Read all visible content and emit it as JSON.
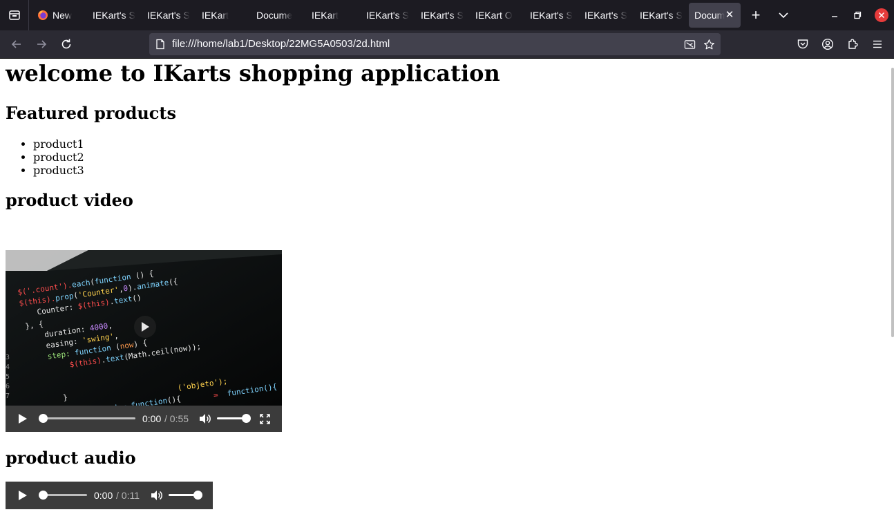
{
  "browser": {
    "tabs": [
      {
        "label": "New",
        "favicon": "firefox-icon"
      },
      {
        "label": "IEKart's S"
      },
      {
        "label": "IEKart's S"
      },
      {
        "label": "IEKart"
      },
      {
        "label": "Docume"
      },
      {
        "label": "IEKart"
      },
      {
        "label": "IEKart's S"
      },
      {
        "label": "IEKart's S"
      },
      {
        "label": "IEKart O"
      },
      {
        "label": "IEKart's S"
      },
      {
        "label": "IEKart's S"
      },
      {
        "label": "IEKart's S"
      },
      {
        "label": "Docum",
        "active": true
      }
    ],
    "url": "file:///home/lab1/Desktop/22MG5A0503/2d.html",
    "colors": {
      "tabbar": "#1c1b22",
      "navbar": "#2b2a33",
      "urlbar": "#42414d",
      "close": "#e63b3b"
    }
  },
  "page": {
    "title": "welcome to IKarts shopping application",
    "featured_heading": "Featured products",
    "products": [
      "product1",
      "product2",
      "product3"
    ],
    "video_heading": "product video",
    "audio_heading": "product audio",
    "video": {
      "current": "0:00",
      "duration": "/ 0:55",
      "volume": 1.0,
      "progress": 0
    },
    "audio": {
      "current": "0:00",
      "duration": "/ 0:11",
      "volume": 1.0,
      "progress": 0
    }
  }
}
